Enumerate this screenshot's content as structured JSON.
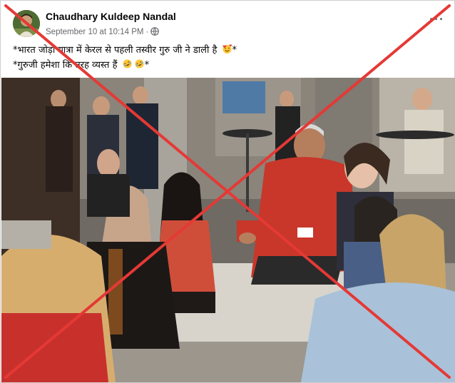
{
  "post": {
    "author": "Chaudhary Kuldeep Nandal",
    "timestamp": "September 10 at 10:14 PM",
    "separator": "·",
    "privacy_icon": "globe-icon",
    "more_icon": "more-options-icon",
    "more_label": "···",
    "text_line_1": "*भारत जोड़ो यात्रा में केरल से पहली तस्वीर गुरु जी ने डाली है",
    "text_line_1_suffix": "*",
    "text_line_2": "*गुरुजी हमेशा कि तरह व्यस्त हैं",
    "text_line_2_suffix": "*",
    "emoji_line_1": "smiling-face-with-hearts",
    "emoji_line_2": "rolling-on-floor-laughing"
  },
  "overlay": {
    "mark": "red-cross-mark",
    "color": "#e53935"
  }
}
